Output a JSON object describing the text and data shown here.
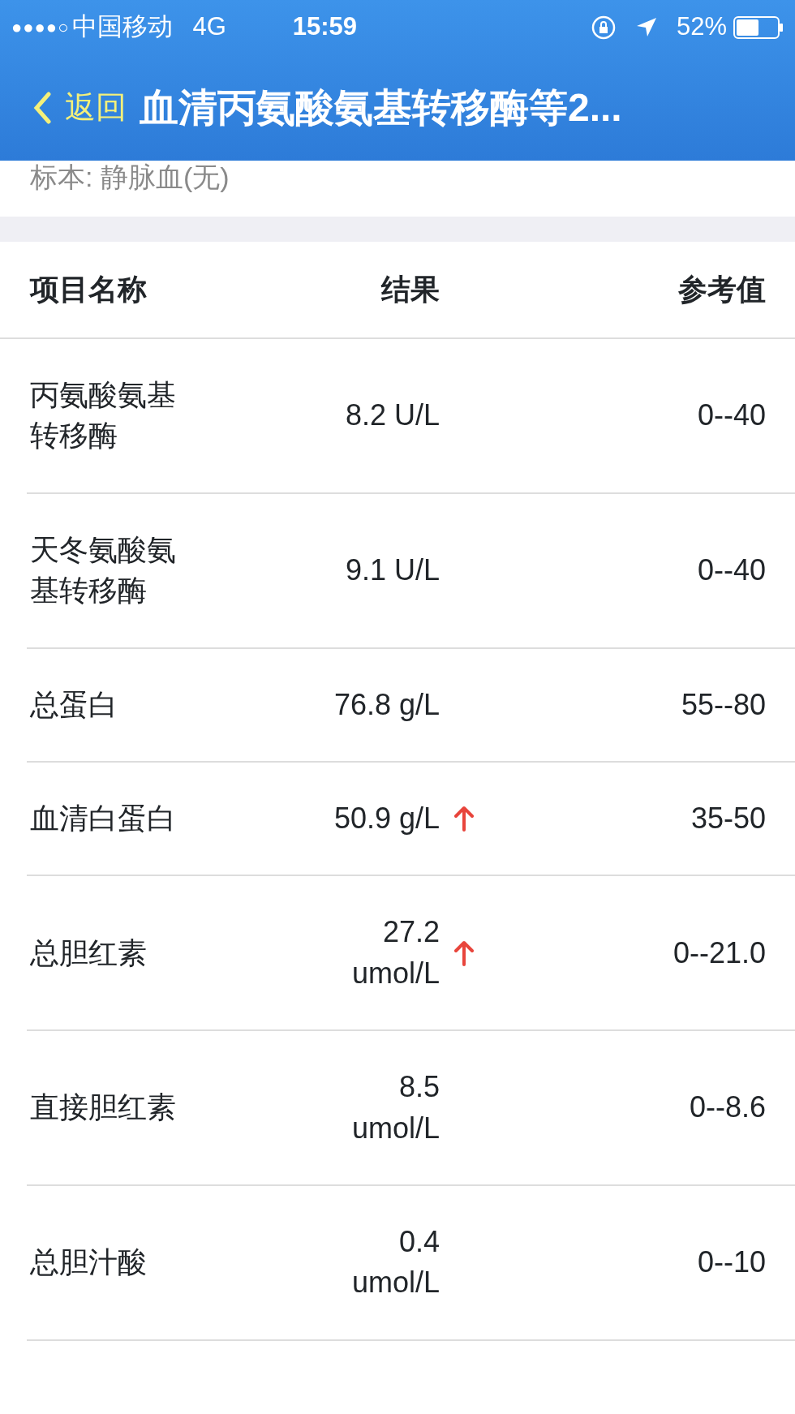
{
  "status_bar": {
    "signal": "●●●●○",
    "carrier": "中国移动",
    "network": "4G",
    "time": "15:59",
    "battery": "52%"
  },
  "nav": {
    "back": "返回",
    "title": "血清丙氨酸氨基转移酶等2..."
  },
  "specimen": "标本: 静脉血(无)",
  "table": {
    "columns": [
      "项目名称",
      "结果",
      "参考值"
    ],
    "rows": [
      {
        "name": "丙氨酸氨基转移酶",
        "result": "8.2 U/L",
        "abnormal": false,
        "reference": "0--40"
      },
      {
        "name": "天冬氨酸氨基转移酶",
        "result": "9.1 U/L",
        "abnormal": false,
        "reference": "0--40"
      },
      {
        "name": "总蛋白",
        "result": "76.8 g/L",
        "abnormal": false,
        "reference": "55--80"
      },
      {
        "name": "血清白蛋白",
        "result": "50.9 g/L",
        "abnormal": true,
        "reference": "35-50"
      },
      {
        "name": "总胆红素",
        "result": "27.2 umol/L",
        "abnormal": true,
        "reference": "0--21.0"
      },
      {
        "name": "直接胆红素",
        "result": "8.5 umol/L",
        "abnormal": false,
        "reference": "0--8.6"
      },
      {
        "name": "总胆汁酸",
        "result": "0.4 umol/L",
        "abnormal": false,
        "reference": "0--10"
      }
    ]
  }
}
